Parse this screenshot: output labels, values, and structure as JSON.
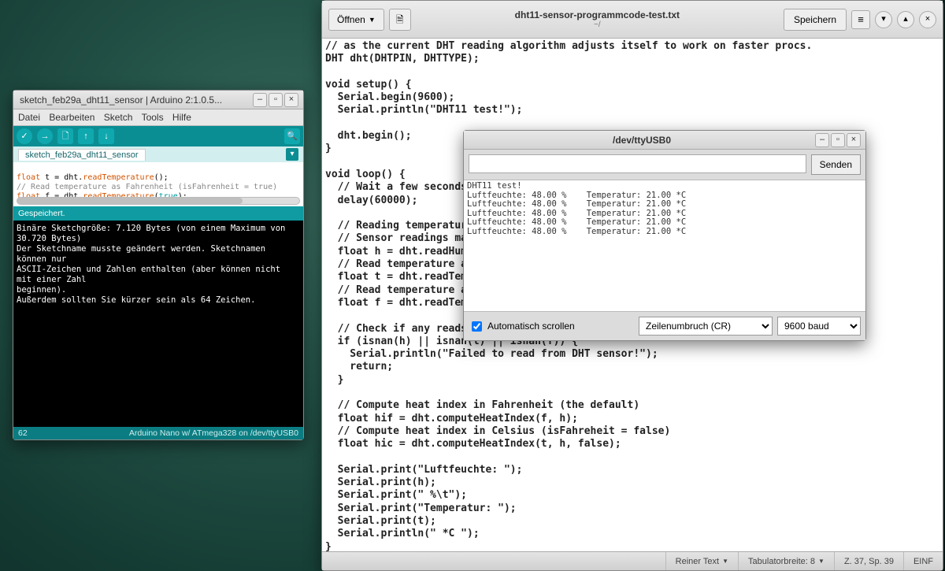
{
  "gedit": {
    "open_label": "Öffnen",
    "save_label": "Speichern",
    "filename": "dht11-sensor-programmcode-test.txt",
    "path": "~/",
    "code": "// as the current DHT reading algorithm adjusts itself to work on faster procs.\nDHT dht(DHTPIN, DHTTYPE);\n\nvoid setup() {\n  Serial.begin(9600);\n  Serial.println(\"DHT11 test!\");\n\n  dht.begin();\n}\n\nvoid loop() {\n  // Wait a few seconds between measurements.\n  delay(60000);\n\n  // Reading temperature or humidity takes about 250 milliseconds!\n  // Sensor readings may also be up to 2 seconds 'old' (its a very slow sensor)\n  float h = dht.readHumidity();\n  // Read temperature as Celsius (the default)\n  float t = dht.readTemperature();\n  // Read temperature as Fahrenheit (isFahrenheit = true)\n  float f = dht.readTemperature(true);\n\n  // Check if any reads failed and exit early (to try again).\n  if (isnan(h) || isnan(t) || isnan(f)) {\n    Serial.println(\"Failed to read from DHT sensor!\");\n    return;\n  }\n\n  // Compute heat index in Fahrenheit (the default)\n  float hif = dht.computeHeatIndex(f, h);\n  // Compute heat index in Celsius (isFahreheit = false)\n  float hic = dht.computeHeatIndex(t, h, false);\n\n  Serial.print(\"Luftfeuchte: \");\n  Serial.print(h);\n  Serial.print(\" %\\t\");\n  Serial.print(\"Temperatur: \");\n  Serial.print(t);\n  Serial.println(\" *C \");\n}",
    "status": {
      "lang": "Reiner Text",
      "tabwidth": "Tabulatorbreite: 8",
      "pos": "Z. 37, Sp. 39",
      "insert": "EINF"
    }
  },
  "arduino": {
    "window_title": "sketch_feb29a_dht11_sensor | Arduino 2:1.0.5...",
    "menus": [
      "Datei",
      "Bearbeiten",
      "Sketch",
      "Tools",
      "Hilfe"
    ],
    "tab_name": "sketch_feb29a_dht11_sensor",
    "editor_html": "<span class='kw'>float</span> t = dht.<span class='kw'>readTemperature</span>();\n<span class='cm'>// Read temperature as Fahrenheit (isFahrenheit = true)</span>\n<span class='kw'>float</span> f = dht.<span class='kw'>readTemperature</span>(<span class='lit'>true</span>);",
    "status_msg": "Gespeichert.",
    "console": "Binäre Sketchgröße: 7.120 Bytes (von einem Maximum von 30.720 Bytes)\nDer Sketchname musste geändert werden. Sketchnamen können nur\nASCII-Zeichen und Zahlen enthalten (aber können nicht mit einer Zahl\nbeginnen).\nAußerdem sollten Sie kürzer sein als 64 Zeichen.",
    "footer_left": "62",
    "footer_right": "Arduino Nano w/ ATmega328 on /dev/ttyUSB0"
  },
  "serial": {
    "title": "/dev/ttyUSB0",
    "send_label": "Senden",
    "autoscroll_label": "Automatisch scrollen",
    "line_ending": "Zeilenumbruch (CR)",
    "baud": "9600 baud",
    "header_line": "DHT11 test!",
    "rows": [
      {
        "h": "48.00",
        "t": "21.00"
      },
      {
        "h": "48.00",
        "t": "21.00"
      },
      {
        "h": "48.00",
        "t": "21.00"
      },
      {
        "h": "48.00",
        "t": "21.00"
      },
      {
        "h": "48.00",
        "t": "21.00"
      }
    ]
  }
}
